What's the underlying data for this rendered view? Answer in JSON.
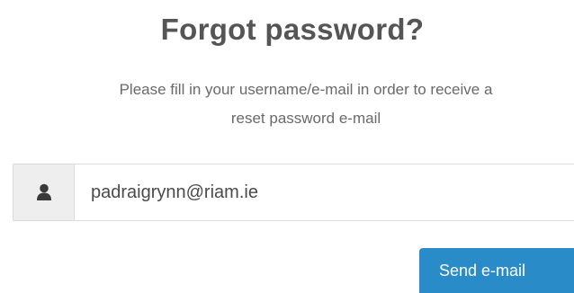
{
  "page": {
    "title": "Forgot password?",
    "instructions_line1": "Please fill in your username/e-mail in order to receive a",
    "instructions_line2": "reset password e-mail"
  },
  "form": {
    "username_value": "padraigrynn@riam.ie",
    "username_icon": "user-icon",
    "send_label": "Send e-mail"
  },
  "colors": {
    "accent": "#2a8bc9",
    "text": "#555555",
    "addon_background": "#eeeeee"
  }
}
